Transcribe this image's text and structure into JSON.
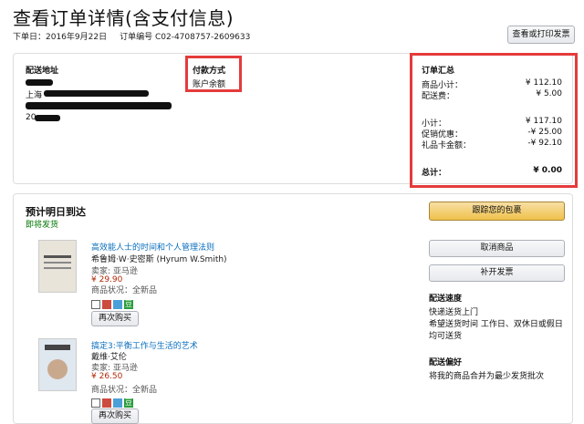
{
  "page": {
    "title": "查看订单详情(含支付信息)",
    "order_date_label": "下单日：2016年9月22日",
    "order_number_label": "订单编号 C02-4708757-2609633",
    "print_button": "查看或打印发票"
  },
  "shipping": {
    "heading": "配送地址",
    "line2_prefix": "上海",
    "line5_prefix": "20"
  },
  "payment": {
    "heading": "付款方式",
    "method": "账户余额"
  },
  "summary": {
    "heading": "订单汇总",
    "rows": [
      {
        "label": "商品小计：",
        "value": "¥ 112.10"
      },
      {
        "label": "配送费：",
        "value": "¥ 5.00"
      },
      {
        "label": "小计：",
        "value": "¥ 117.10"
      },
      {
        "label": "促销优惠：",
        "value": "-¥ 25.00"
      },
      {
        "label": "礼品卡金额：",
        "value": "-¥ 92.10"
      }
    ],
    "total_label": "总计：",
    "total_value": "¥ 0.00"
  },
  "shipment": {
    "eta": "预计明日到达",
    "status": "即将发货",
    "track_button": "跟踪您的包裹",
    "cancel_button": "取消商品",
    "invoice_button": "补开发票",
    "speed_heading": "配送速度",
    "speed_value": "快递送货上门",
    "time_value": "希望送货时间 工作日、双休日或假日均可送货",
    "pref_heading": "配送偏好",
    "pref_value": "将我的商品合并为最少发货批次"
  },
  "items": [
    {
      "title": "高效能人士的时间和个人管理法则",
      "author": "希鲁姆·W·史密斯 (Hyrum W.Smith)",
      "seller": "卖家: 亚马逊",
      "price": "¥ 29.90",
      "condition": "商品状况：全新品",
      "badge": "豆",
      "rebuy": "再次购买"
    },
    {
      "title": "搞定3:平衡工作与生活的艺术",
      "author": "戴维·艾伦",
      "seller": "卖家: 亚马逊",
      "price": "¥ 26.50",
      "condition": "商品状况：全新品",
      "badge": "豆",
      "rebuy": "再次购买"
    }
  ],
  "colors": {
    "highlight": "#e53b3b",
    "link": "#0a6ebd",
    "price": "#b12704",
    "in_stock": "#007600",
    "track_button": "#f0c14b"
  }
}
